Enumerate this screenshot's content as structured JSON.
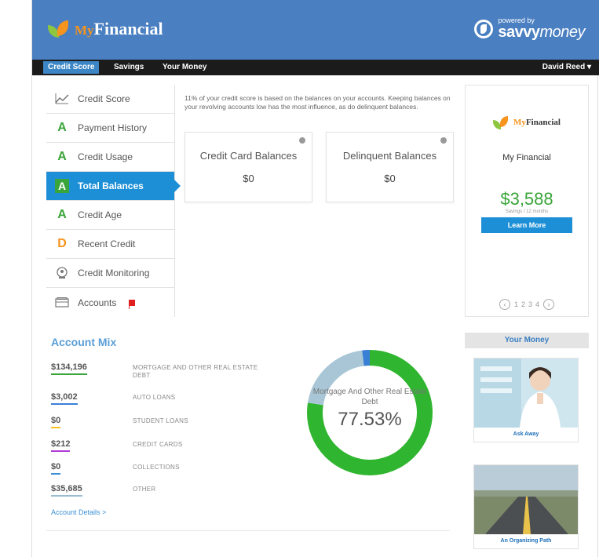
{
  "header": {
    "logo_my": "My",
    "logo_name": "Financial",
    "powered_small": "powered by",
    "powered_brand_bold": "savvy",
    "powered_brand_light": "money"
  },
  "nav": {
    "tabs": [
      "Credit Score",
      "Savings",
      "Your Money"
    ],
    "user": "David Reed ▾"
  },
  "sidebar": {
    "items": [
      {
        "label": "Credit Score",
        "grade": "",
        "icon": "chart-icon"
      },
      {
        "label": "Payment History",
        "grade": "A"
      },
      {
        "label": "Credit Usage",
        "grade": "A"
      },
      {
        "label": "Total Balances",
        "grade": "A",
        "active": true
      },
      {
        "label": "Credit Age",
        "grade": "A"
      },
      {
        "label": "Recent Credit",
        "grade": "D"
      },
      {
        "label": "Credit Monitoring",
        "grade": "",
        "icon": "monitor-icon"
      },
      {
        "label": "Accounts",
        "grade": "",
        "icon": "card-icon"
      }
    ]
  },
  "info_text": "11% of your credit score is based on the balances on your accounts. Keeping balances on your revolving accounts low has the most influence, as do delinquent balances.",
  "cards": [
    {
      "title": "Credit Card Balances",
      "value": "$0"
    },
    {
      "title": "Delinquent Balances",
      "value": "$0"
    }
  ],
  "promo": {
    "logo_my": "My",
    "logo_name": "Financial",
    "name": "My Financial",
    "amount": "$3,588",
    "sub": "Savings / 12 months",
    "button": "Learn More",
    "pages": [
      "1",
      "2",
      "3",
      "4"
    ],
    "prev": "‹",
    "next": "›"
  },
  "account_mix": {
    "title": "Account Mix",
    "rows": [
      {
        "amount": "$134,196",
        "label": "MORTGAGE AND OTHER REAL ESTATE DEBT",
        "color": "#3aa53a"
      },
      {
        "amount": "$3,002",
        "label": "AUTO LOANS",
        "color": "#3a7fd6"
      },
      {
        "amount": "$0",
        "label": "STUDENT LOANS",
        "color": "#f7c21d"
      },
      {
        "amount": "$212",
        "label": "CREDIT CARDS",
        "color": "#b03ad6"
      },
      {
        "amount": "$0",
        "label": "COLLECTIONS",
        "color": "#3a8fd6"
      },
      {
        "amount": "$35,685",
        "label": "OTHER",
        "color": "#9abcd0"
      }
    ],
    "details_link": "Account Details >",
    "donut_label": "Mortgage And Other Real Estate Debt",
    "donut_pct": "77.53%",
    "donut_fraction": 0.7753,
    "donut_colors": {
      "main": "#2fb52f",
      "auto": "#3a7fd6",
      "other": "#a9c6d6"
    }
  },
  "your_money": {
    "title": "Your Money",
    "items": [
      {
        "caption": "Ask Away"
      },
      {
        "caption": "An Organizing Path"
      }
    ]
  }
}
